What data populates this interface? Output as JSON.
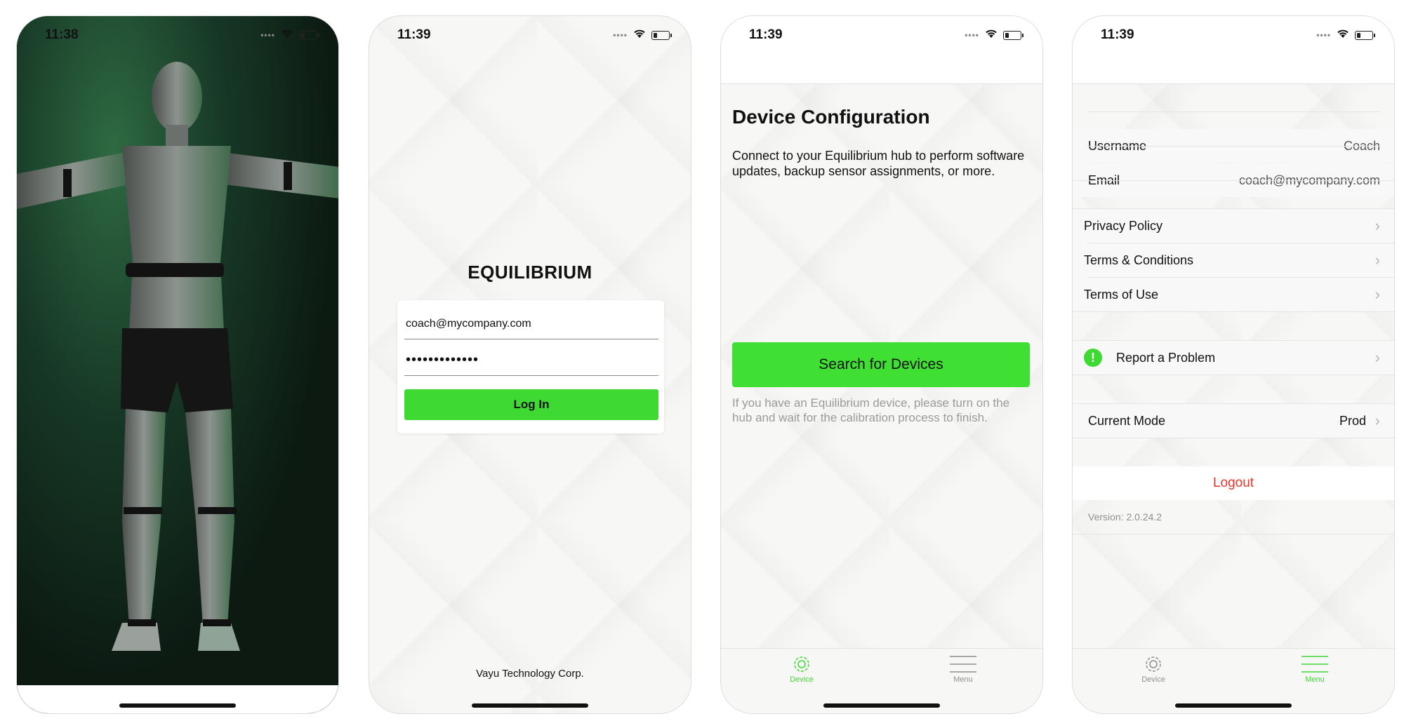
{
  "phone1": {
    "time": "11:38"
  },
  "phone2": {
    "time": "11:39",
    "app_title": "EQUILIBRIUM",
    "email_value": "coach@mycompany.com",
    "password_value": "•••••••••••••",
    "login_label": "Log In",
    "company": "Vayu Technology Corp."
  },
  "phone3": {
    "time": "11:39",
    "title": "Device Configuration",
    "description": "Connect to your Equilibrium hub to perform software updates, backup sensor assignments, or more.",
    "search_label": "Search for Devices",
    "hint": "If you have an Equilibrium device, please turn on the hub and wait for the calibration process to finish.",
    "tabs": [
      {
        "label": "Device",
        "icon": "gear-icon",
        "active": true
      },
      {
        "label": "Menu",
        "icon": "menu-icon",
        "active": false
      }
    ]
  },
  "phone4": {
    "time": "11:39",
    "username_label": "Username",
    "username_value": "Coach",
    "email_label": "Email",
    "email_value": "coach@mycompany.com",
    "privacy_policy": "Privacy Policy",
    "terms_conditions": "Terms & Conditions",
    "terms_use": "Terms of Use",
    "report_problem": "Report a Problem",
    "current_mode_label": "Current Mode",
    "current_mode_value": "Prod",
    "logout": "Logout",
    "version": "Version: 2.0.24.2",
    "tabs": [
      {
        "label": "Device",
        "icon": "gear-icon",
        "active": false
      },
      {
        "label": "Menu",
        "icon": "menu-icon",
        "active": true
      }
    ]
  },
  "colors": {
    "accent_green": "#3fd933",
    "logout_red": "#e8362d"
  }
}
